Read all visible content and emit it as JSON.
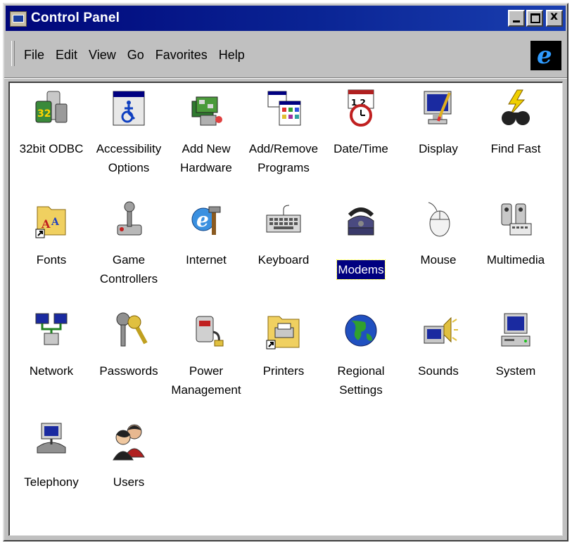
{
  "window": {
    "title": "Control Panel"
  },
  "menu": {
    "items": [
      {
        "label": "File"
      },
      {
        "label": "Edit"
      },
      {
        "label": "View"
      },
      {
        "label": "Go"
      },
      {
        "label": "Favorites"
      },
      {
        "label": "Help"
      }
    ]
  },
  "icons": [
    {
      "label": "32bit ODBC",
      "icon": "odbc-icon"
    },
    {
      "label": "Accessibility Options",
      "icon": "accessibility-icon"
    },
    {
      "label": "Add New Hardware",
      "icon": "hardware-icon"
    },
    {
      "label": "Add/Remove Programs",
      "icon": "programs-icon"
    },
    {
      "label": "Date/Time",
      "icon": "datetime-icon"
    },
    {
      "label": "Display",
      "icon": "display-icon"
    },
    {
      "label": "Find Fast",
      "icon": "find-fast-icon"
    },
    {
      "label": "Fonts",
      "icon": "fonts-icon"
    },
    {
      "label": "Game Controllers",
      "icon": "joystick-icon"
    },
    {
      "label": "Internet",
      "icon": "internet-icon"
    },
    {
      "label": "Keyboard",
      "icon": "keyboard-icon"
    },
    {
      "label": "Modems",
      "icon": "modem-icon",
      "selected": true
    },
    {
      "label": "Mouse",
      "icon": "mouse-icon"
    },
    {
      "label": "Multimedia",
      "icon": "multimedia-icon"
    },
    {
      "label": "Network",
      "icon": "network-icon"
    },
    {
      "label": "Passwords",
      "icon": "keys-icon"
    },
    {
      "label": "Power Management",
      "icon": "power-icon"
    },
    {
      "label": "Printers",
      "icon": "printers-icon"
    },
    {
      "label": "Regional Settings",
      "icon": "globe-icon"
    },
    {
      "label": "Sounds",
      "icon": "sounds-icon"
    },
    {
      "label": "System",
      "icon": "system-icon"
    },
    {
      "label": "Telephony",
      "icon": "telephony-icon"
    },
    {
      "label": "Users",
      "icon": "users-icon"
    }
  ],
  "colors": {
    "title_bar": "#00067a",
    "selection": "#000080",
    "window_face": "#c0c0c0"
  }
}
